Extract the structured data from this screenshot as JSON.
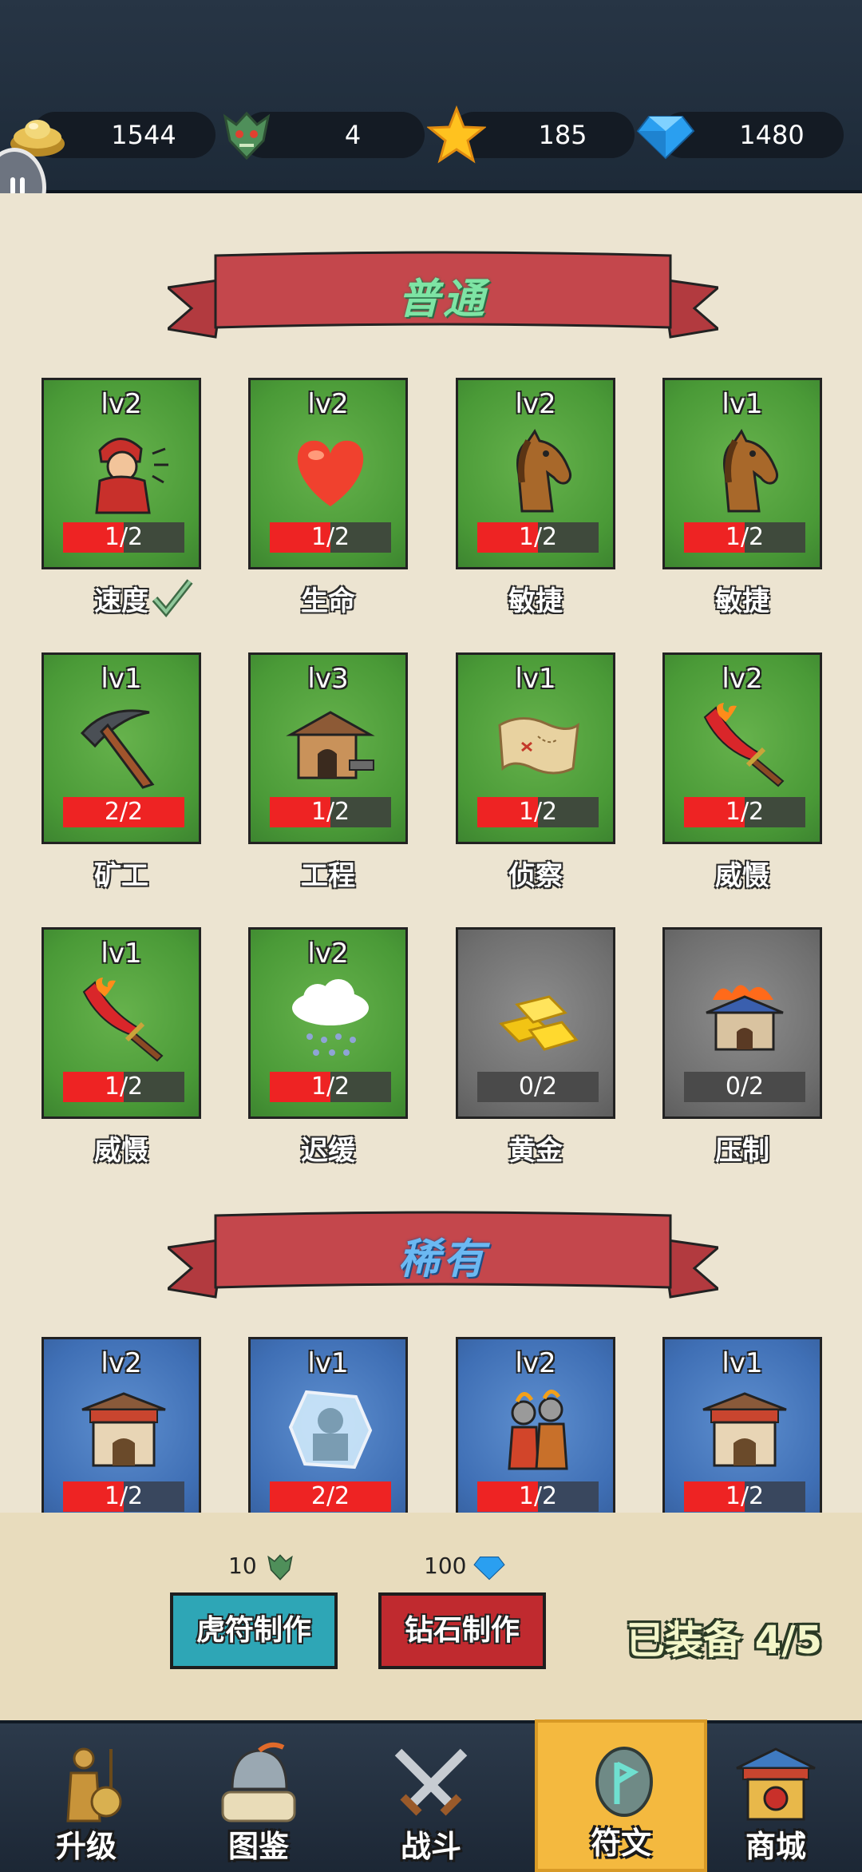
{
  "resources": [
    {
      "icon": "gold-ingot-icon",
      "value": "1544"
    },
    {
      "icon": "tiger-tally-icon",
      "value": "4"
    },
    {
      "icon": "star-icon",
      "value": "185"
    },
    {
      "icon": "diamond-icon",
      "value": "1480"
    }
  ],
  "sections": {
    "common": {
      "title": "普通"
    },
    "rare": {
      "title": "稀有"
    }
  },
  "common_runes": [
    {
      "level": "lv2",
      "progress": "1/2",
      "fill": 0.5,
      "name": "速度",
      "icon": "running-soldier-icon",
      "locked": false,
      "checked": true
    },
    {
      "level": "lv2",
      "progress": "1/2",
      "fill": 0.5,
      "name": "生命",
      "icon": "heart-icon",
      "locked": false
    },
    {
      "level": "lv2",
      "progress": "1/2",
      "fill": 0.5,
      "name": "敏捷",
      "icon": "horse-icon",
      "locked": false
    },
    {
      "level": "lv1",
      "progress": "1/2",
      "fill": 0.5,
      "name": "敏捷",
      "icon": "horse-icon",
      "locked": false
    },
    {
      "level": "lv1",
      "progress": "2/2",
      "fill": 1.0,
      "name": "矿工",
      "icon": "pickaxe-icon",
      "locked": false
    },
    {
      "level": "lv3",
      "progress": "1/2",
      "fill": 0.5,
      "name": "工程",
      "icon": "forge-icon",
      "locked": false
    },
    {
      "level": "lv1",
      "progress": "1/2",
      "fill": 0.5,
      "name": "侦察",
      "icon": "map-scroll-icon",
      "locked": false
    },
    {
      "level": "lv2",
      "progress": "1/2",
      "fill": 0.5,
      "name": "威慑",
      "icon": "flaming-sword-icon",
      "locked": false
    },
    {
      "level": "lv1",
      "progress": "1/2",
      "fill": 0.5,
      "name": "威慑",
      "icon": "flaming-sword-icon",
      "locked": false
    },
    {
      "level": "lv2",
      "progress": "1/2",
      "fill": 0.5,
      "name": "迟缓",
      "icon": "rain-cloud-icon",
      "locked": false
    },
    {
      "level": "",
      "progress": "0/2",
      "fill": 0,
      "name": "黄金",
      "icon": "gold-bars-icon",
      "locked": true
    },
    {
      "level": "",
      "progress": "0/2",
      "fill": 0,
      "name": "压制",
      "icon": "burning-fortress-icon",
      "locked": true
    }
  ],
  "rare_runes": [
    {
      "level": "lv2",
      "progress": "1/2",
      "fill": 0.5,
      "icon": "city-gate-icon"
    },
    {
      "level": "lv1",
      "progress": "2/2",
      "fill": 1.0,
      "icon": "frozen-soldier-icon"
    },
    {
      "level": "lv2",
      "progress": "1/2",
      "fill": 0.5,
      "icon": "warriors-icon"
    },
    {
      "level": "lv1",
      "progress": "1/2",
      "fill": 0.5,
      "icon": "city-gate-icon"
    }
  ],
  "craft": {
    "tally_cost": "10",
    "diamond_cost": "100",
    "tally_button": "虎符制作",
    "diamond_button": "钻石制作",
    "equipped": "已装备 4/5"
  },
  "nav": [
    {
      "label": "升级",
      "icon": "warrior-statue-icon",
      "active": false
    },
    {
      "label": "图鉴",
      "icon": "helmet-scroll-icon",
      "active": false
    },
    {
      "label": "战斗",
      "icon": "crossed-swords-icon",
      "active": false
    },
    {
      "label": "符文",
      "icon": "rune-stone-icon",
      "active": true
    },
    {
      "label": "商城",
      "icon": "shop-gate-icon",
      "active": false
    }
  ],
  "colors": {
    "common_card": "#4a9a37",
    "locked_card": "#6f6f6f",
    "rare_card": "#3f6fb5",
    "progress_fill": "#ee2323",
    "active_tab": "#f4b93f"
  }
}
